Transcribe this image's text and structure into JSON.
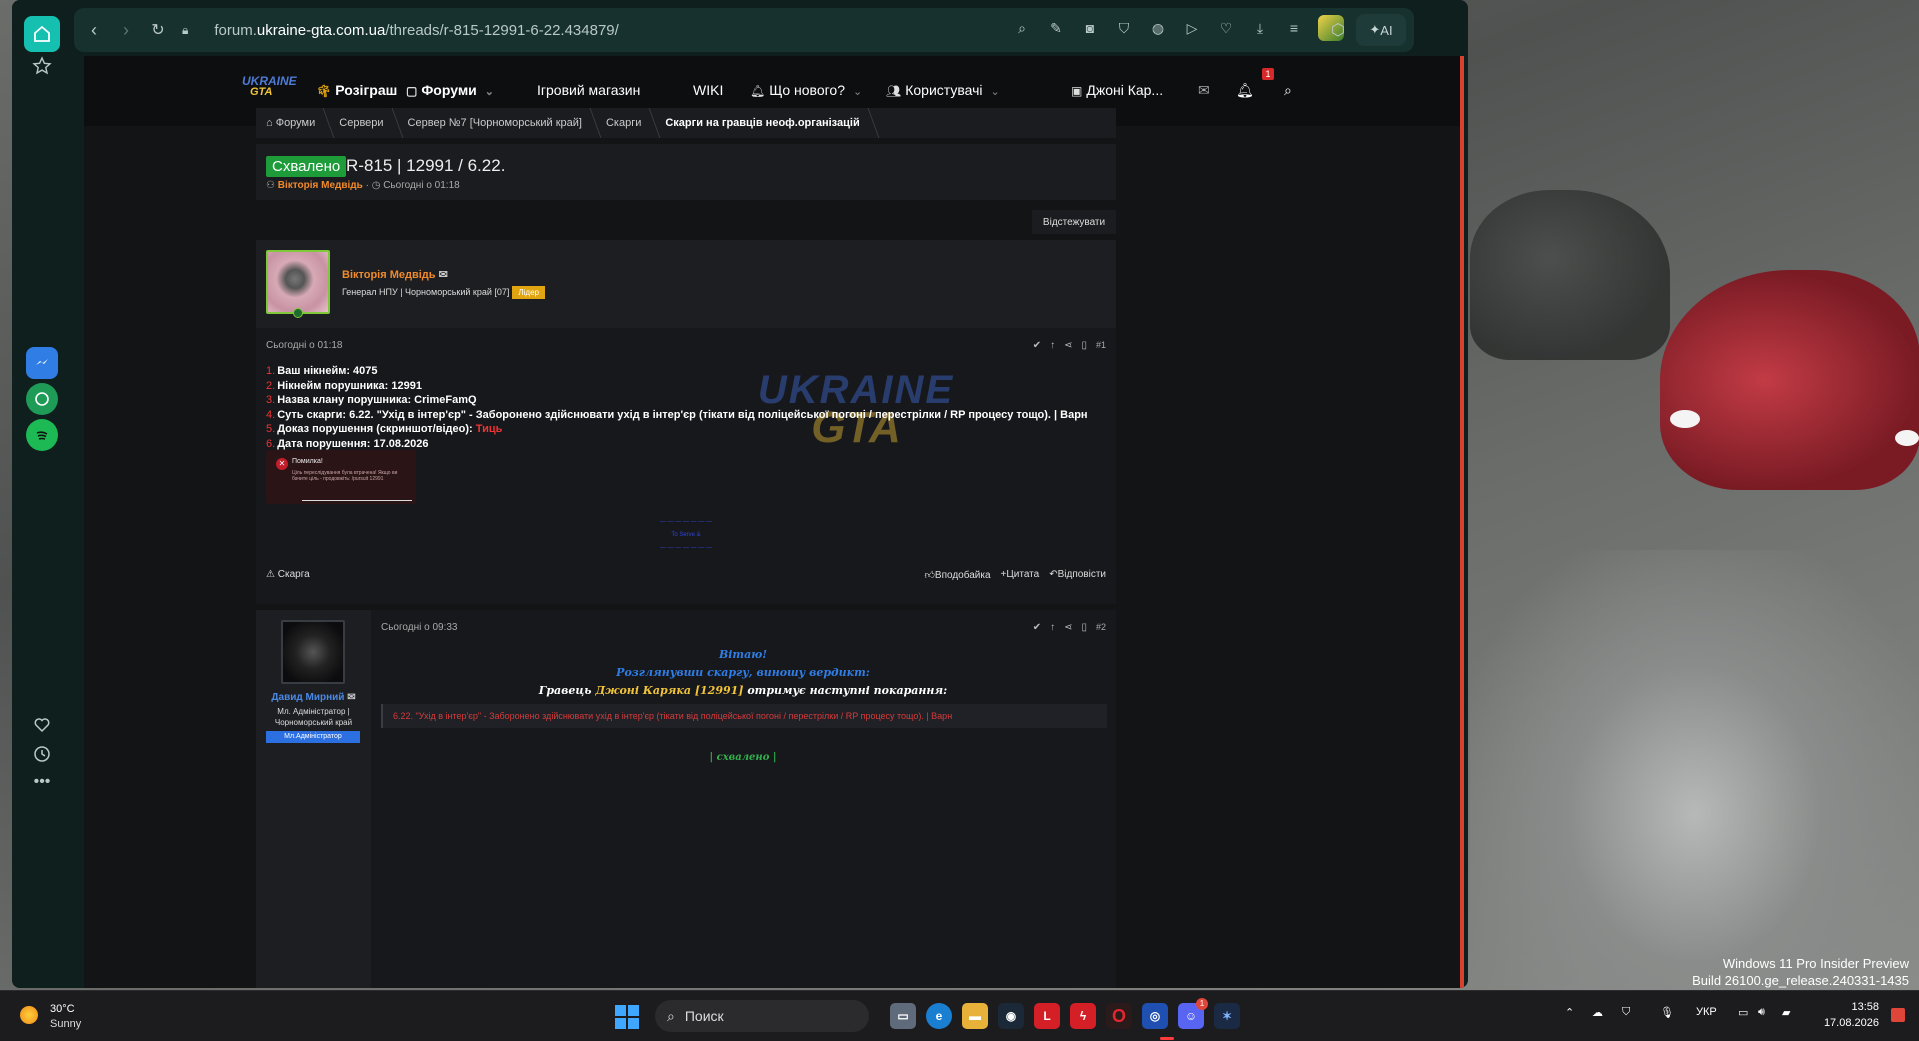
{
  "desktop": {
    "watermark_line1": "Windows 11 Pro Insider Preview",
    "watermark_line2": "Build 26100.ge_release.240331-1435"
  },
  "browser": {
    "url_prefix": "forum.",
    "url_domain": "ukraine-gta.com.ua",
    "url_path": "/threads/r-815-12991-6-22.434879/",
    "ai_label": "AI"
  },
  "site": {
    "logo_line1": "UKRAINE",
    "logo_line2": "GTA",
    "nav": {
      "giveaway": "Розіграш",
      "forums": "Форуми",
      "shop": "Ігровий магазин",
      "wiki": "WIKI",
      "whats_new": "Що нового?",
      "users": "Користувачі",
      "account": "Джоні Кар...",
      "alerts_count": "1"
    },
    "breadcrumb": [
      "Форуми",
      "Сервери",
      "Сервер №7 [Чорноморський край]",
      "Скарги",
      "Скарги на гравців неоф.організацій"
    ],
    "thread": {
      "status": "Схвалено",
      "title": "R-815 | 12991 / 6.22.",
      "author": "Вікторія Медвідь",
      "date": "Сьогодні о 01:18",
      "watch_button": "Відстежувати"
    },
    "post1": {
      "author": "Вікторія Медвідь",
      "rank": "Генерал НПУ | Чорноморський край [07]",
      "badge": "Лідер",
      "time": "Сьогодні о 01:18",
      "number": "#1",
      "lines": [
        {
          "n": "1.",
          "text": "Ваш нікнейм: 4075"
        },
        {
          "n": "2.",
          "text": "Нікнейм порушника: 12991"
        },
        {
          "n": "3.",
          "text": "Назва клану порушника: CrimeFamQ"
        },
        {
          "n": "4.",
          "text": "Суть скарги: 6.22. \"Ухід в інтер'єр\" - Заборонено здійснювати ухід в інтер'єр (тікати від поліцейської погоні / перестрілки / RP процесу тощо). | Варн"
        },
        {
          "n": "5.",
          "text": "Доказ порушення (скриншот/відео): "
        },
        {
          "n": "6.",
          "text": "Дата порушення: 17.08.2026"
        }
      ],
      "proof_link": "Тиць",
      "error_title": "Помилка!",
      "error_text": "Ціль переслідування була втрачена! Якщо ви бачите ціль - продовжіть: /pursuit 12991",
      "signature_lines": [
        "— — — — — — —",
        "To Serve &",
        "— — — — — — —"
      ],
      "report": "Скарга",
      "like": "Вподобайка",
      "quote": "Цитата",
      "reply": "Відповісти"
    },
    "post2": {
      "author": "Давид Мирний",
      "rank": "Мл. Адміністратор | Чорноморський край",
      "badge": "Мл.Адміністратор",
      "time": "Сьогодні о 09:33",
      "number": "#2",
      "greeting": "Вітаю!",
      "verdict_line": "Розглянувши скаргу, виношу вердикт:",
      "player_prefix": "Гравець",
      "player_name": "Джоні Каряка [12991]",
      "player_suffix": "отримує наступні покарання:",
      "rule": "6.22. \"Ухід в інтер'єр\" - Заборонено здійснювати ухід в інтер'єр (тікати від поліцейської погоні / перестрілки / RP процесу тощо). | Варн",
      "approved": "| схвалено |"
    }
  },
  "taskbar": {
    "weather_temp": "30°C",
    "weather_desc": "Sunny",
    "search": "Поиск",
    "lang": "УКР",
    "time": "13:58",
    "date": "17.08.2026",
    "discord_badge": "1"
  }
}
